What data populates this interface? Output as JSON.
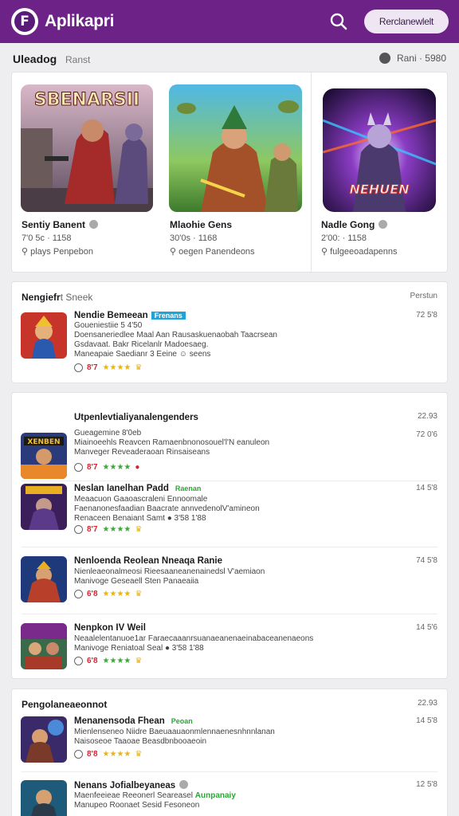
{
  "header": {
    "app_name": "Aplikapri",
    "logo_letter": "F",
    "cta_label": "Rerclanewlelt",
    "brand_color": "#6c2287"
  },
  "section": {
    "title": "Uleadog",
    "subtitle": "Ranst",
    "right_label": "Rani · 5980"
  },
  "featured": [
    {
      "title": "Sentiy Banent",
      "meta": "7'0 5c · 1158",
      "developer": "plays Penpebon",
      "art_text": "SBENARSII"
    },
    {
      "title": "Mlaohie Gens",
      "meta": "30'0s · 1168",
      "developer": "oegen Panendeons",
      "art_text": ""
    },
    {
      "title": "Nadle Gong",
      "meta": "2'00: · 1158",
      "developer": "fulgeeoadapenns",
      "art_text": "NEHUEN"
    }
  ],
  "list1": {
    "heading": "Nengiefr",
    "heading_sub": "t Sneek",
    "right": "Perstun",
    "rows": [
      {
        "title": "Nendie Bemeean",
        "tag": "Frenans",
        "desc1": "Goueniestiie 5 4'50",
        "desc2": "Doensaneriedlee Maal Aan Rausaskuenaobah Taacrsean",
        "desc3": "Gsdavaat. Bakr Ricelanlr Madoesaeg.",
        "desc4": "Maneapaie Saedianr 3 Eeine ☺ seens",
        "score": "8'7",
        "time": "72 5'8"
      }
    ]
  },
  "list2": {
    "rows": [
      {
        "title": "Utpenlevtialiyanalengenders",
        "tag": "",
        "desc1": "Gueagemine 8'0eb",
        "desc2": "Miainoeehls Reavcen Ramaenbnonosouel'l'N eanuleon",
        "desc3": "Manveger Reveaderaoan Rinsaiseans",
        "score": "8'7",
        "time": "22.93",
        "time2": "72 0'6"
      },
      {
        "title": "Neslan Ianelhan Padd",
        "tag": "Raenan",
        "desc1": "Meaacuon Gaaoascraleni Ennoomale",
        "desc2": "Faenanonesfaadian Baacrate annvedenolV'amineon",
        "desc3": "Renaceen Benaiant Samt ● 3'58 1'88",
        "score": "8'7",
        "time": "14 5'8"
      },
      {
        "title": "Nenloenda Reolean Nneaqa Ranie",
        "tag": "",
        "desc1": "Nienleaeonalmeosi Rieesaaneanenainedsl V'aemiaon",
        "desc2": "Manivoge Geseaell Sten Panaeaiia",
        "desc3": "",
        "score": "6'8",
        "time": "74 5'8"
      },
      {
        "title": "Nenpkon IV Weil",
        "tag": "",
        "desc1": "Neaalelentanuoe1ar Faraecaaanrsuanaeanenaeinabaceanenaeons",
        "desc2": "Manivoge Reniatoal Seal ● 3'58 1'88",
        "desc3": "",
        "score": "6'8",
        "time": "14 5'6"
      }
    ]
  },
  "list3": {
    "heading": "Pengolaneaeonnot",
    "right": "22.93",
    "rows": [
      {
        "title": "Menanensoda Fhean",
        "tag": "Peoan",
        "desc1": "Mienlenseneo Niidre Baeuaauaonmlennaenesnhnnlanan",
        "desc2": "Naisoseoe Taaoae Beasdbnbooaeoin",
        "score": "8'8",
        "time": "14 5'8"
      },
      {
        "title": "Nenans Jofialbeyaneas",
        "tag": "Aunpanaiy",
        "desc1": "Maenfeeieae Reeonerl Seareasel",
        "desc2": "Manupeo Roonaet Sesid Fesoneon",
        "score": "",
        "time": "12 5'8"
      }
    ]
  },
  "colors": {
    "accent": "#6c2287",
    "score_red": "#d6252e",
    "star_gold": "#e8b414",
    "tag_blue": "#1fa3d8",
    "tag_green": "#2aa536"
  }
}
